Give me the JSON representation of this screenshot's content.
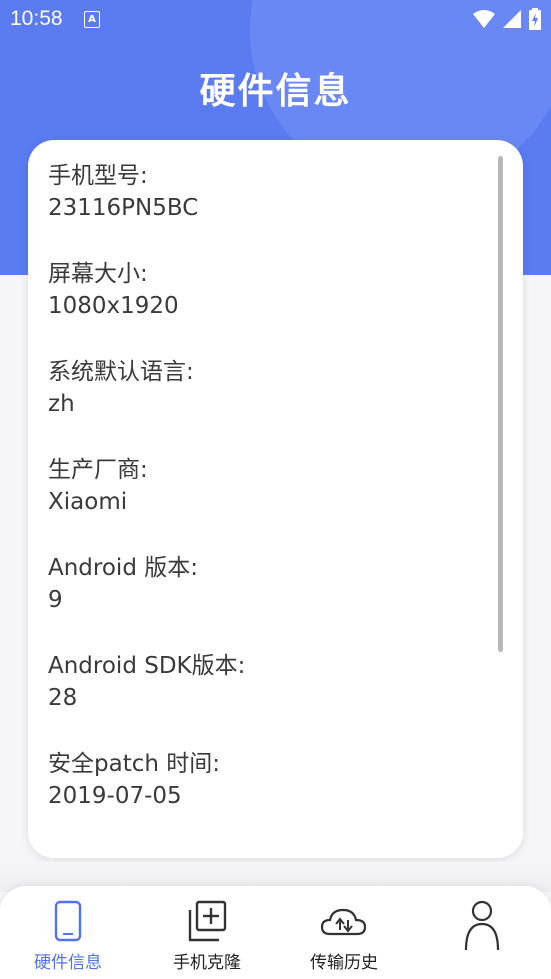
{
  "status_bar": {
    "time": "10:58",
    "notification_icon": "A"
  },
  "header": {
    "title": "硬件信息"
  },
  "info_items": [
    {
      "label": "手机型号:",
      "value": "23116PN5BC"
    },
    {
      "label": "屏幕大小:",
      "value": "1080x1920"
    },
    {
      "label": "系统默认语言:",
      "value": "zh"
    },
    {
      "label": "生产厂商:",
      "value": "Xiaomi"
    },
    {
      "label": "Android 版本:",
      "value": "9"
    },
    {
      "label": "Android SDK版本:",
      "value": "28"
    },
    {
      "label": "安全patch 时间:",
      "value": "2019-07-05"
    }
  ],
  "bottom_nav": [
    {
      "label": "硬件信息",
      "icon": "phone-icon",
      "active": true
    },
    {
      "label": "手机克隆",
      "icon": "add-copy-icon",
      "active": false
    },
    {
      "label": "传输历史",
      "icon": "cloud-transfer-icon",
      "active": false
    },
    {
      "label": "",
      "icon": "person-icon",
      "active": false
    }
  ],
  "colors": {
    "accent": "#5b7cf0",
    "active_nav": "#4f72ee",
    "text": "#3a3a3a"
  }
}
